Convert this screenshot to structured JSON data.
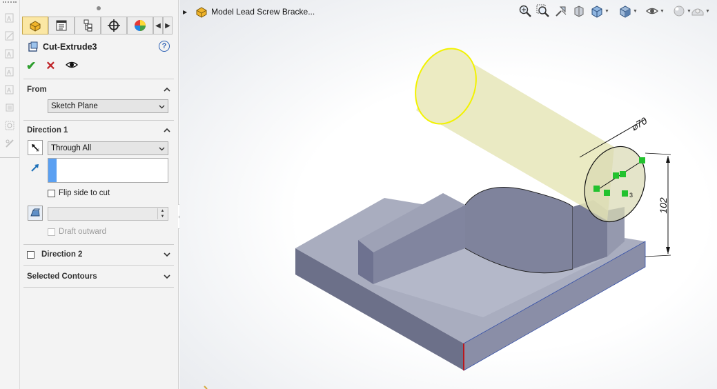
{
  "document": {
    "title": "Model Lead Screw Bracke..."
  },
  "property_manager": {
    "feature_name": "Cut-Extrude3",
    "help_glyph": "?",
    "sections": {
      "from": {
        "title": "From",
        "end_condition": "Sketch Plane"
      },
      "direction1": {
        "title": "Direction 1",
        "end_condition": "Through All",
        "flip_side_label": "Flip side to cut",
        "draft_outward_label": "Draft outward",
        "selection_value": ""
      },
      "direction2": {
        "title": "Direction 2"
      },
      "selected_contours": {
        "title": "Selected Contours"
      }
    }
  },
  "annotations": {
    "diameter_dim": "⌀70",
    "height_dim": "102",
    "relation_glyph": "3"
  },
  "colors": {
    "accept_green": "#2e9e2e",
    "cancel_red": "#c0262b",
    "selection_blue": "#5aa0f2",
    "model_gray": "#8c90a6",
    "cut_preview_yellow": "#e6e6b8"
  },
  "icons": {
    "tabs": [
      "feature-manager-icon",
      "property-manager-icon",
      "configuration-manager-icon",
      "dimxpert-icon",
      "display-manager-icon"
    ],
    "view_toolbar": [
      "zoom-to-fit-icon",
      "zoom-to-area-icon",
      "previous-view-icon",
      "section-view-icon",
      "view-orientation-icon",
      "display-style-icon",
      "hide-show-items-icon",
      "edit-appearance-icon",
      "apply-scene-icon"
    ]
  }
}
